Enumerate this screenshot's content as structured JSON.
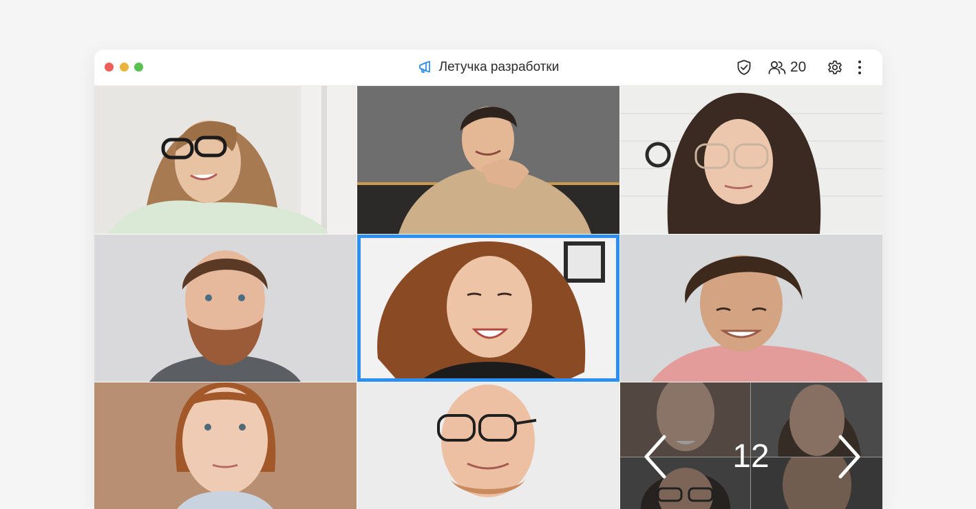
{
  "window": {
    "title": "Летучка разработки",
    "title_icon": "megaphone-icon",
    "accent_color": "#2e8ff3"
  },
  "toolbar": {
    "security_icon": "shield-check-icon",
    "participants_icon": "people-icon",
    "participants_count": "20",
    "settings_icon": "gear-icon",
    "more_icon": "more-vertical-icon"
  },
  "grid": {
    "tiles": [
      {
        "person": "woman-glasses-long-hair",
        "active": false
      },
      {
        "person": "man-beige-hoodie",
        "active": false
      },
      {
        "person": "woman-curly-hair-glasses",
        "active": false
      },
      {
        "person": "man-beard",
        "active": false
      },
      {
        "person": "woman-curly-laughing",
        "active": true
      },
      {
        "person": "young-man-curly-pink-shirt",
        "active": false
      },
      {
        "person": "woman-red-hair",
        "active": false
      },
      {
        "person": "bald-man-glasses",
        "active": false
      }
    ],
    "overflow": {
      "more_count": "12",
      "prev_icon": "chevron-left-icon",
      "next_icon": "chevron-right-icon"
    }
  }
}
